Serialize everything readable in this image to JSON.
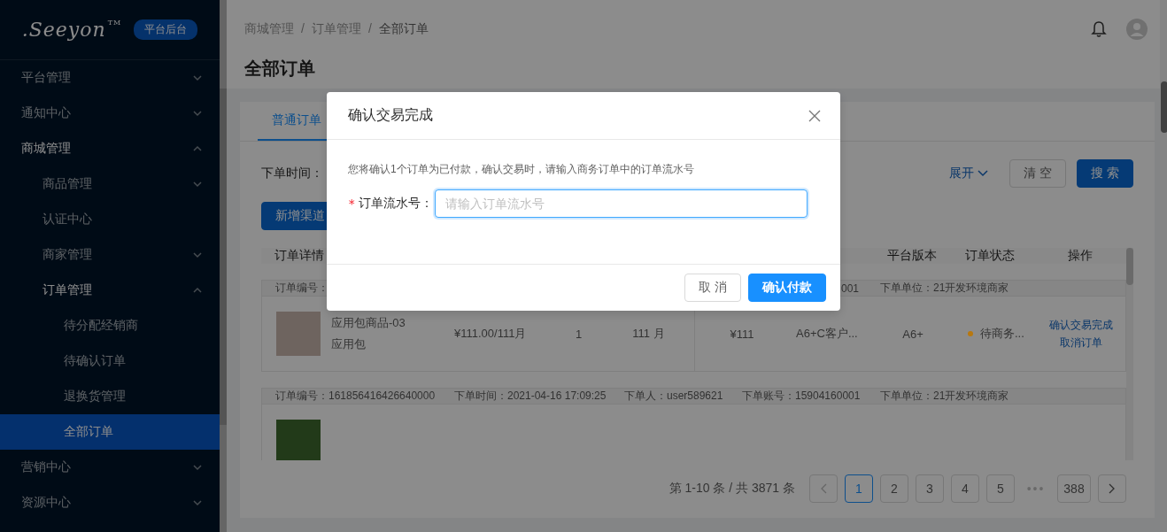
{
  "sidebar": {
    "logo": ".Seeyon",
    "trademark": "TM",
    "badge": "平台后台",
    "items": [
      {
        "label": "平台管理",
        "expanded": false,
        "selected": false
      },
      {
        "label": "通知中心",
        "expanded": false,
        "selected": false
      },
      {
        "label": "商城管理",
        "expanded": true,
        "selected": false,
        "children": [
          {
            "label": "商品管理",
            "expanded": false,
            "selected": false
          },
          {
            "label": "认证中心",
            "selected": false
          },
          {
            "label": "商家管理",
            "expanded": false,
            "selected": false
          },
          {
            "label": "订单管理",
            "expanded": true,
            "selected": false,
            "children": [
              {
                "label": "待分配经销商",
                "selected": false
              },
              {
                "label": "待确认订单",
                "selected": false
              },
              {
                "label": "退换货管理",
                "selected": false
              },
              {
                "label": "全部订单",
                "selected": true
              }
            ]
          }
        ]
      },
      {
        "label": "营销中心",
        "expanded": false,
        "selected": false
      },
      {
        "label": "资源中心",
        "expanded": false,
        "selected": false
      }
    ]
  },
  "header": {
    "breadcrumb": [
      "商城管理",
      "订单管理",
      "全部订单"
    ],
    "separator": "/",
    "title": "全部订单"
  },
  "tabs": [
    {
      "label": "普通订单",
      "selected": true
    }
  ],
  "filter": {
    "label": "下单时间：",
    "expand": "展开",
    "clear": "清 空",
    "search": "搜 索"
  },
  "add_button": "新增渠道",
  "table": {
    "columns": [
      {
        "kind": "detail",
        "label": "订单详情"
      },
      {
        "kind": "version",
        "label": "平台版本"
      },
      {
        "kind": "status",
        "label": "订单状态"
      },
      {
        "kind": "action",
        "label": "操作"
      }
    ],
    "orders": [
      {
        "fields": [
          {
            "kind": "number",
            "text": "订单编号："
          },
          {
            "kind": "account",
            "text": "001"
          },
          {
            "kind": "unit",
            "text": "下单单位：21开发环境商家"
          }
        ],
        "items": [
          {
            "kind": "product",
            "name": "应用包商品-03",
            "type": "应用包",
            "price": "¥111.00/111月",
            "quantity": "1",
            "duration": "111 月",
            "amount": "¥111",
            "customer": "A6+C客户...",
            "version": "A6+",
            "status": "待商务...",
            "color": "#b8780f",
            "actions": [
              "确认交易完成",
              "取消订单"
            ]
          }
        ]
      },
      {
        "fields": [
          {
            "kind": "number",
            "text": "订单编号：161856416426640000"
          },
          {
            "kind": "time",
            "text": "下单时间：2021-04-16 17:09:25"
          },
          {
            "kind": "buyer",
            "text": "下单人：user589621"
          },
          {
            "kind": "account",
            "text": "下单账号：15904160001"
          },
          {
            "kind": "unit",
            "text": "下单单位：21开发环境商家"
          }
        ],
        "items": [
          {
            "kind": "photo_only"
          }
        ]
      }
    ]
  },
  "pagination": {
    "summary": "第 1-10 条 / 共 3871 条",
    "pages": [
      {
        "label": "1",
        "selected": true
      },
      {
        "label": "2",
        "selected": false
      },
      {
        "label": "3",
        "selected": false
      },
      {
        "label": "4",
        "selected": false
      },
      {
        "label": "5",
        "selected": false
      }
    ],
    "ellipsis": "•••",
    "last": {
      "label": "388",
      "selected": false
    }
  },
  "dialog": {
    "title": "确认交易完成",
    "message": "您将确认1个订单为已付款，确认交易时，请输入商务订单中的订单流水号",
    "required_mark": "*",
    "label": "订单流水号：",
    "placeholder": "请输入订单流水号",
    "focused": true,
    "cancel": "取 消",
    "confirm": "确认付款"
  }
}
